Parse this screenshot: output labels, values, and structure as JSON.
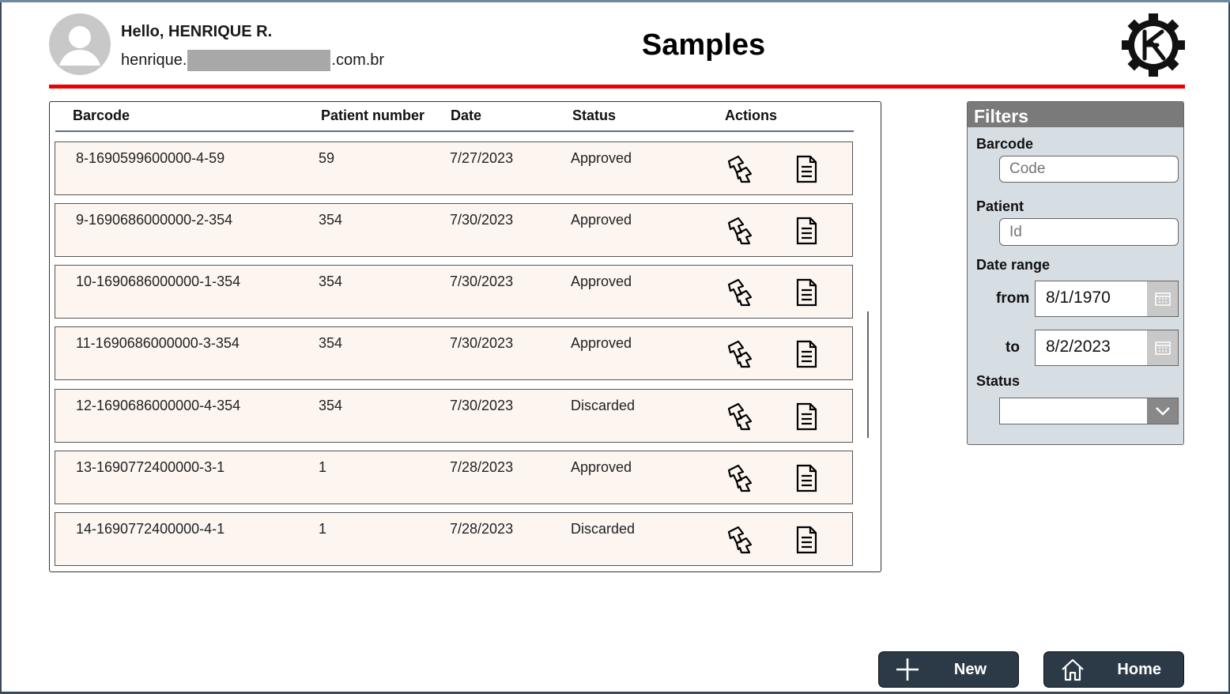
{
  "user": {
    "greeting": "Hello, HENRIQUE R.",
    "email_prefix": "henrique.",
    "email_suffix": ".com.br"
  },
  "page_title": "Samples",
  "colors": {
    "accent_line": "#ee0000",
    "row_bg": "#fdf6f0",
    "button_bg": "#2c3a47",
    "filters_header_bg": "#7a7a7a",
    "filters_bg": "#d6dde3"
  },
  "table": {
    "columns": [
      "Barcode",
      "Patient number",
      "Date",
      "Status",
      "Actions"
    ],
    "rows": [
      {
        "barcode": "8-1690599600000-4-59",
        "patient": "59",
        "date": "7/27/2023",
        "status": "Approved"
      },
      {
        "barcode": "9-1690686000000-2-354",
        "patient": "354",
        "date": "7/30/2023",
        "status": "Approved"
      },
      {
        "barcode": "10-1690686000000-1-354",
        "patient": "354",
        "date": "7/30/2023",
        "status": "Approved"
      },
      {
        "barcode": "11-1690686000000-3-354",
        "patient": "354",
        "date": "7/30/2023",
        "status": "Approved"
      },
      {
        "barcode": "12-1690686000000-4-354",
        "patient": "354",
        "date": "7/30/2023",
        "status": "Discarded"
      },
      {
        "barcode": "13-1690772400000-3-1",
        "patient": "1",
        "date": "7/28/2023",
        "status": "Approved"
      },
      {
        "barcode": "14-1690772400000-4-1",
        "patient": "1",
        "date": "7/28/2023",
        "status": "Discarded"
      }
    ],
    "action_icons": [
      "review-icon",
      "document-icon"
    ]
  },
  "filters": {
    "title": "Filters",
    "barcode_label": "Barcode",
    "barcode_placeholder": "Code",
    "patient_label": "Patient",
    "patient_placeholder": "Id",
    "date_range_label": "Date range",
    "from_label": "from",
    "from_value": "8/1/1970",
    "to_label": "to",
    "to_value": "8/2/2023",
    "status_label": "Status",
    "status_value": ""
  },
  "buttons": {
    "new_label": "New",
    "home_label": "Home"
  }
}
